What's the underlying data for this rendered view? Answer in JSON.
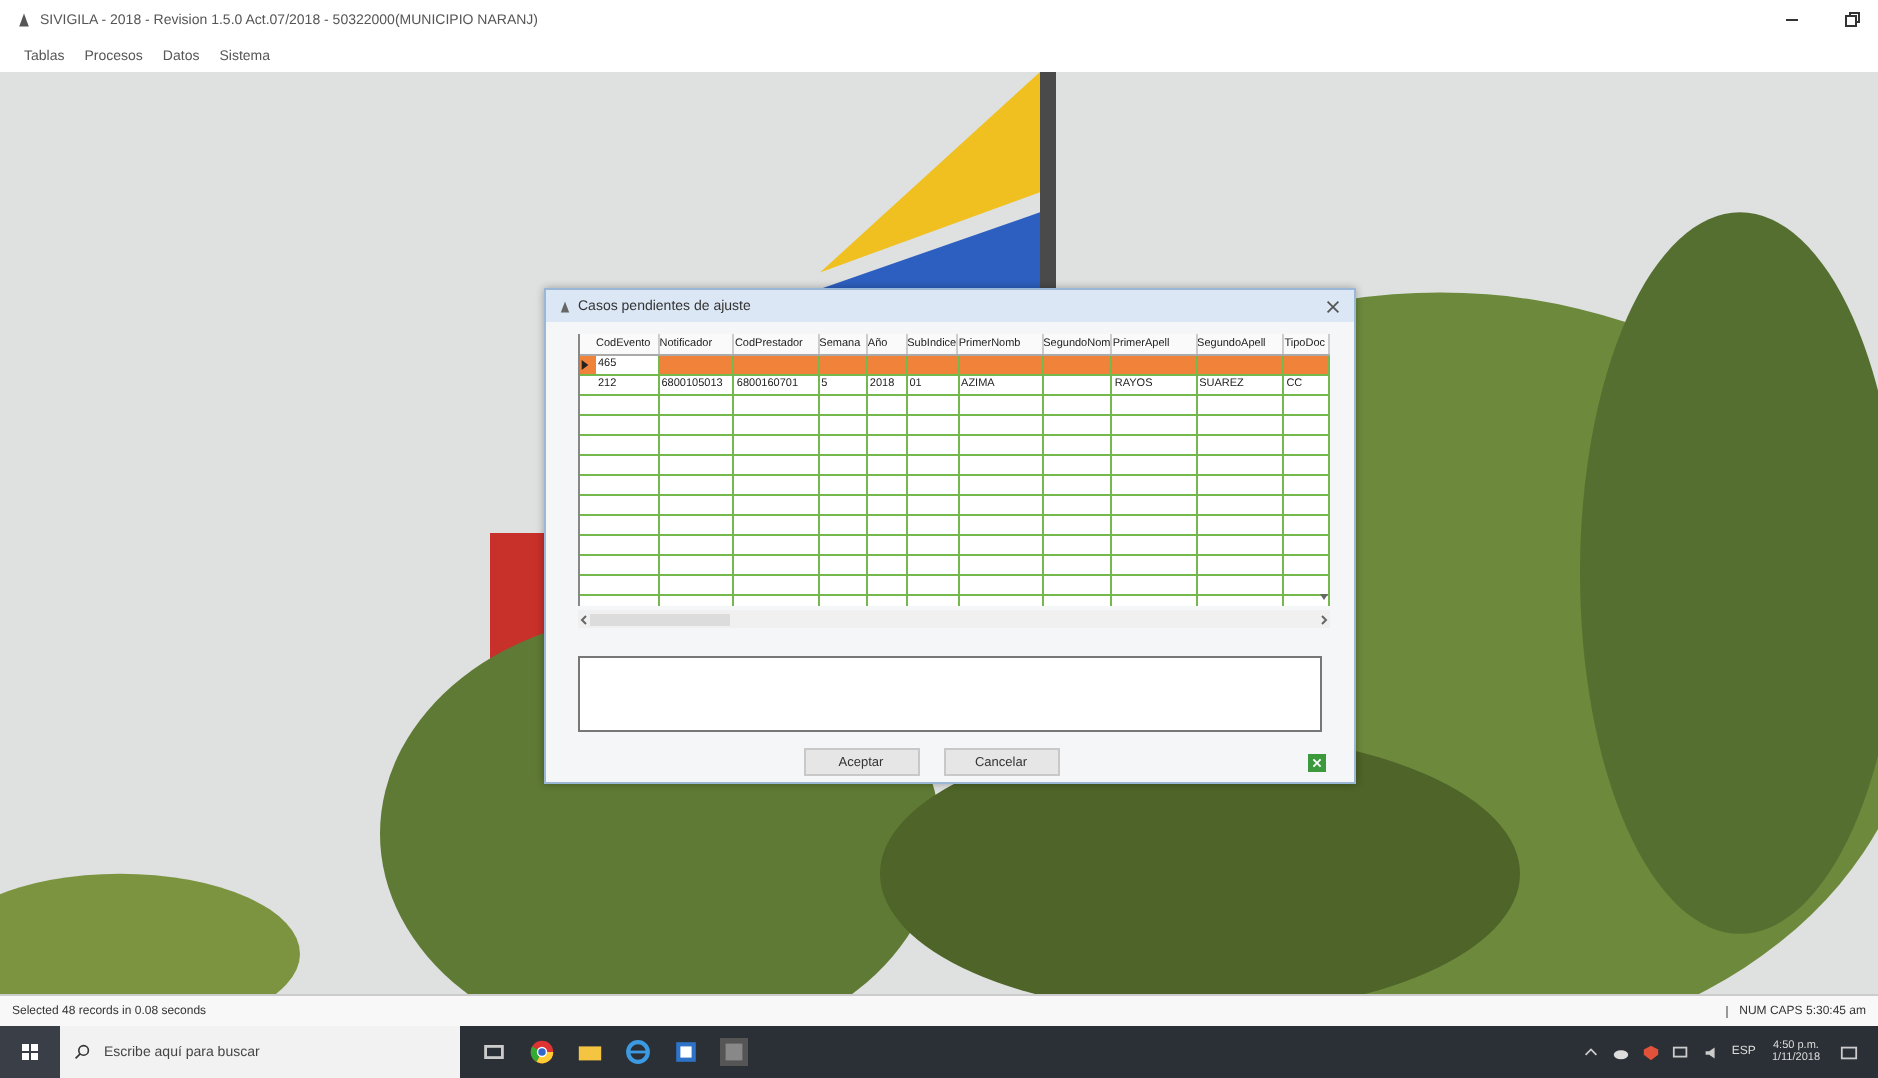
{
  "window": {
    "title": "SIVIGILA - 2018 - Revision 1.5.0 Act.07/2018 - 50322000(MUNICIPIO NARANJ)"
  },
  "menu": [
    "Tablas",
    "Procesos",
    "Datos",
    "Sistema"
  ],
  "dialog": {
    "title": "Casos pendientes de ajuste",
    "columns": [
      "CodEvento",
      "Notificador",
      "CodPrestador",
      "Semana",
      "Año",
      "SubIndice",
      "PrimerNomb",
      "SegundoNom",
      "PrimerApell",
      "SegundoApell",
      "TipoDoc"
    ],
    "rows": [
      {
        "selected": true,
        "cells": [
          "465",
          null,
          null,
          null,
          null,
          null,
          null,
          null,
          null,
          null,
          null
        ]
      },
      {
        "selected": false,
        "cells": [
          "212",
          "6800105013",
          "6800160701",
          "5",
          "2018",
          "01",
          "AZIMA",
          null,
          "RAYOS",
          "SUAREZ",
          "CC"
        ]
      }
    ],
    "buttons": [
      "Aceptar",
      "Cancelar"
    ]
  },
  "status_bar": {
    "message": "Selected 48 records in 0.08 seconds",
    "indicators": "NUM CAPS 5:30:45 am"
  },
  "taskbar": {
    "search_placeholder": "Escribe aquí para buscar",
    "language": "ESP",
    "time": "4:50 p.m.",
    "date": "1/11/2018"
  }
}
